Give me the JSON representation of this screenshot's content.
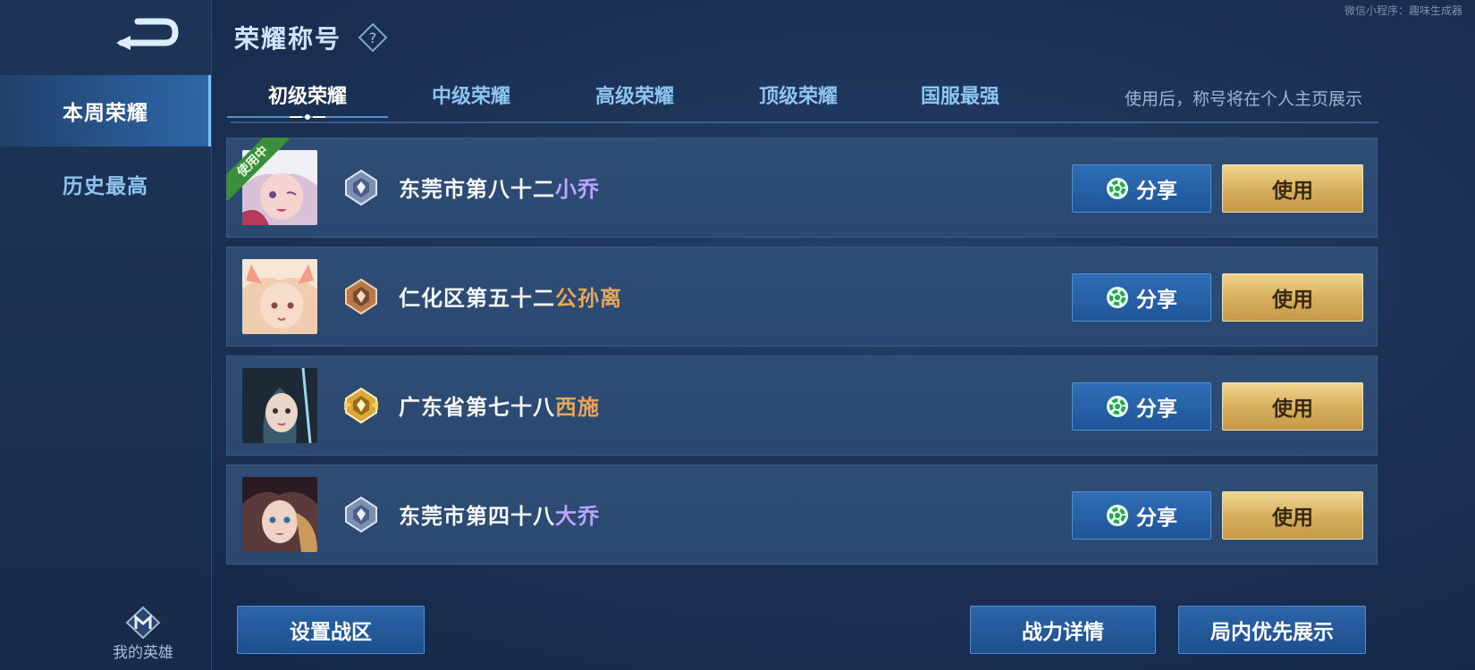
{
  "watermark": "微信小程序：趣味生成器",
  "sidebar": {
    "items": [
      {
        "label": "本周荣耀",
        "active": true
      },
      {
        "label": "历史最高",
        "active": false
      }
    ],
    "my_heroes_label": "我的英雄"
  },
  "header": {
    "title": "荣耀称号"
  },
  "tabs": {
    "items": [
      {
        "label": "初级荣耀",
        "active": true
      },
      {
        "label": "中级荣耀",
        "active": false
      },
      {
        "label": "高级荣耀",
        "active": false
      },
      {
        "label": "顶级荣耀",
        "active": false
      },
      {
        "label": "国服最强",
        "active": false
      }
    ],
    "hint": "使用后，称号将在个人主页展示"
  },
  "rows": [
    {
      "prefix": "东莞市第八十二",
      "hero": "小乔",
      "hero_color": "#b9a5ff",
      "badge": "silver",
      "in_use": true,
      "in_use_label": "使用中",
      "share_label": "分享",
      "use_label": "使用"
    },
    {
      "prefix": "仁化区第五十二",
      "hero": "公孙离",
      "hero_color": "#e5a65b",
      "badge": "bronze",
      "in_use": false,
      "share_label": "分享",
      "use_label": "使用"
    },
    {
      "prefix": "广东省第七十八",
      "hero": "西施",
      "hero_color": "#e5a65b",
      "badge": "gold",
      "in_use": false,
      "share_label": "分享",
      "use_label": "使用"
    },
    {
      "prefix": "东莞市第四十八",
      "hero": "大乔",
      "hero_color": "#b9a5ff",
      "badge": "silver",
      "in_use": false,
      "share_label": "分享",
      "use_label": "使用"
    }
  ],
  "bottom": {
    "set_region": "设置战区",
    "power_details": "战力详情",
    "priority_display": "局内优先展示"
  },
  "colors": {
    "accent_blue": "#4c8fd6",
    "gold_button": "#d6ad5b",
    "active_tab": "#ffffff",
    "inactive_tab": "#8cc4f2"
  }
}
